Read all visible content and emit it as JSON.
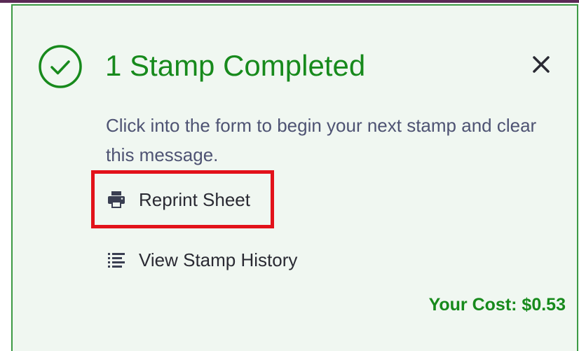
{
  "notification": {
    "title": "1 Stamp Completed",
    "message": "Click into the form to begin your next stamp and clear this message.",
    "actions": {
      "reprint_label": "Reprint Sheet",
      "history_label": "View Stamp History"
    },
    "cost_label": "Your Cost: $0.53"
  },
  "icons": {
    "status": "check-circle-icon",
    "close": "close-icon",
    "reprint": "printer-icon",
    "history": "list-icon"
  },
  "colors": {
    "success": "#178a1c",
    "panel_background": "#f0f7f1",
    "panel_border": "#3c9a44",
    "message_text": "#4e5373",
    "highlight": "#e2121a"
  }
}
